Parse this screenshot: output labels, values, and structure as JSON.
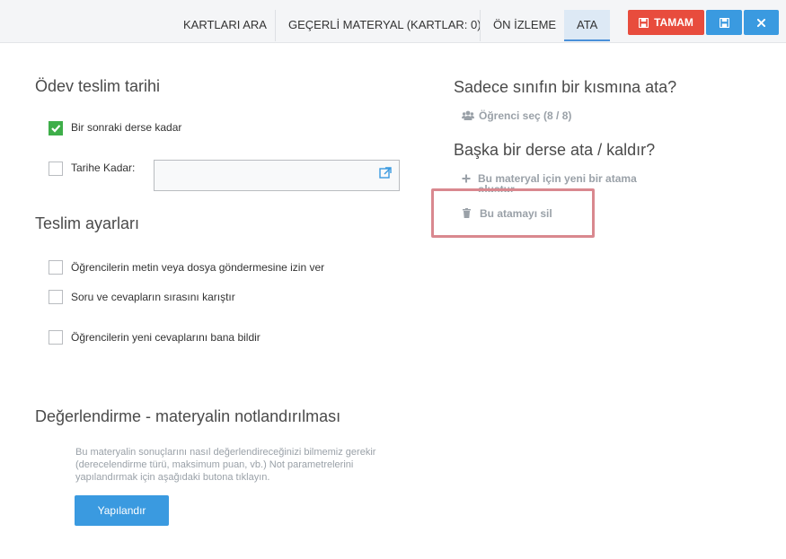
{
  "tabs": [
    {
      "label": "KARTLARI ARA"
    },
    {
      "label": "GEÇERLİ MATERYAL (KARTLAR: 0)"
    },
    {
      "label": "ÖN İZLEME"
    },
    {
      "label": "ATA"
    }
  ],
  "toolbar": {
    "ok_label": "TAMAM"
  },
  "due": {
    "title": "Ödev teslim tarihi",
    "next_lesson_label": "Bir sonraki derse kadar",
    "next_lesson_checked": true,
    "until_date_label": "Tarihe Kadar:",
    "until_date_value": ""
  },
  "submission": {
    "title": "Teslim ayarları",
    "options": [
      {
        "label": "Öğrencilerin metin veya dosya göndermesine izin ver",
        "checked": false
      },
      {
        "label": "Soru ve cevapların sırasını karıştır",
        "checked": false
      },
      {
        "label": "Öğrencilerin yeni cevaplarını bana bildir",
        "checked": false
      }
    ]
  },
  "partial": {
    "title": "Sadece sınıfın bir kısmına ata?",
    "select_students": "Öğrenci seç (8 / 8)"
  },
  "other_lesson": {
    "title": "Başka bir derse ata / kaldır?",
    "new_assignment_line1": "Bu materyal için yeni bir atama",
    "new_assignment_line2": "oluştur",
    "delete_assignment": "Bu atamayı sil"
  },
  "grading": {
    "title": "Değerlendirme - materyalin notlandırılması",
    "description": "Bu materyalin sonuçlarını nasıl değerlendireceğinizi bilmemiz gerekir (derecelendirme türü, maksimum puan, vb.) Not parametrelerini yapılandırmak için aşağıdaki butona tıklayın.",
    "configure_label": "Yapılandır"
  },
  "colors": {
    "accent": "#3a9ae0",
    "danger": "#e84c3d",
    "check": "#3eae49",
    "highlight_box": "#d9888f"
  }
}
